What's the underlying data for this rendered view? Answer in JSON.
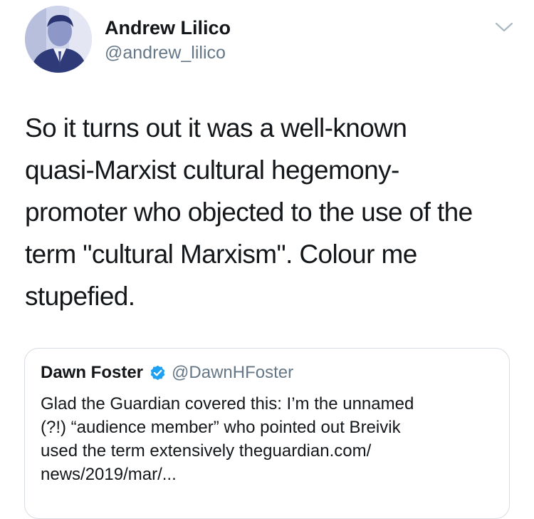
{
  "tweet": {
    "author_name": "Andrew Lilico",
    "author_handle": "@andrew_lilico",
    "text_lines": [
      "So it turns out it was a well-known",
      "quasi-Marxist cultural hegemony-",
      "promoter who objected to the use of the",
      "term \"cultural Marxism\". Colour me",
      "stupefied."
    ],
    "menu_icon": "chevron-down-icon",
    "avatar_icon": "avatar"
  },
  "quote": {
    "author_name": "Dawn Foster",
    "author_handle": "@DawnHFoster",
    "verified_icon": "verified-badge-icon",
    "text_lines": [
      "Glad the Guardian covered this: I’m the unnamed",
      "(?!) “audience member” who pointed out Breivik",
      "used the term extensively theguardian.com/",
      "news/2019/mar/..."
    ]
  },
  "colors": {
    "text_primary": "#14171a",
    "text_secondary": "#657786",
    "border": "#d7dde2",
    "verified_blue": "#1da1f2"
  }
}
